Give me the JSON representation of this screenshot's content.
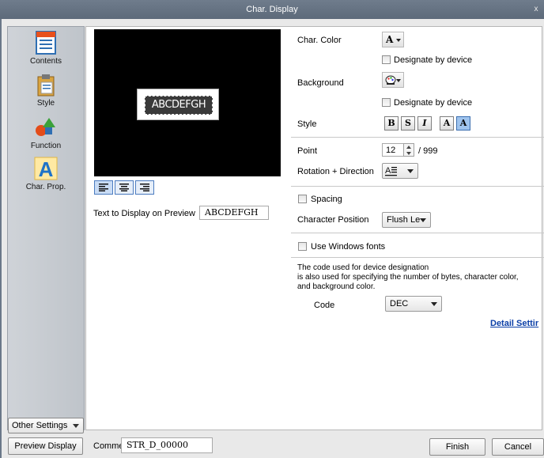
{
  "window": {
    "title": "Char. Display",
    "close_glyph": "x"
  },
  "sidebar": {
    "items": [
      {
        "label": "Contents",
        "icon": "contents-icon"
      },
      {
        "label": "Style",
        "icon": "style-icon"
      },
      {
        "label": "Function",
        "icon": "function-icon"
      },
      {
        "label": "Char. Prop.",
        "icon": "char-prop-icon",
        "selected": true
      }
    ],
    "other_settings_label": "Other Settings"
  },
  "preview": {
    "display_text": "ABCDEFGH",
    "text_to_display_label": "Text to Display on Preview",
    "text_to_display_value": "ABCDEFGH",
    "alignment_buttons": [
      "align-left",
      "align-center",
      "align-right"
    ]
  },
  "props": {
    "char_color_label": "Char. Color",
    "char_color_glyph": "A",
    "designate_by_device_label": "Designate by device",
    "background_label": "Background",
    "designate_by_device_label2": "Designate by device",
    "style_label": "Style",
    "style_buttons": [
      "B",
      "S",
      "I",
      "A",
      "A"
    ],
    "point_label": "Point",
    "point_value": "12",
    "point_max": "/ 999",
    "rotation_label": "Rotation + Direction",
    "spacing_label": "Spacing",
    "char_position_label": "Character Position",
    "char_position_value": "Flush Le",
    "use_windows_fonts_label": "Use Windows fonts",
    "note_line1": "The code used for device designation",
    "note_line2": " is also used for specifying the number of bytes, character color,",
    "note_line3": "and background color.",
    "code_label": "Code",
    "code_value": "DEC",
    "detail_link": "Detail Settir"
  },
  "footer": {
    "preview_display_label": "Preview Display",
    "comment_label": "Comme",
    "comment_value": "STR_D_00000",
    "finish_label": "Finish",
    "cancel_label": "Cancel"
  },
  "colors": {
    "title_bar": "#5d6a7a",
    "link": "#0b3fa7",
    "selection": "#4c7cc0"
  }
}
